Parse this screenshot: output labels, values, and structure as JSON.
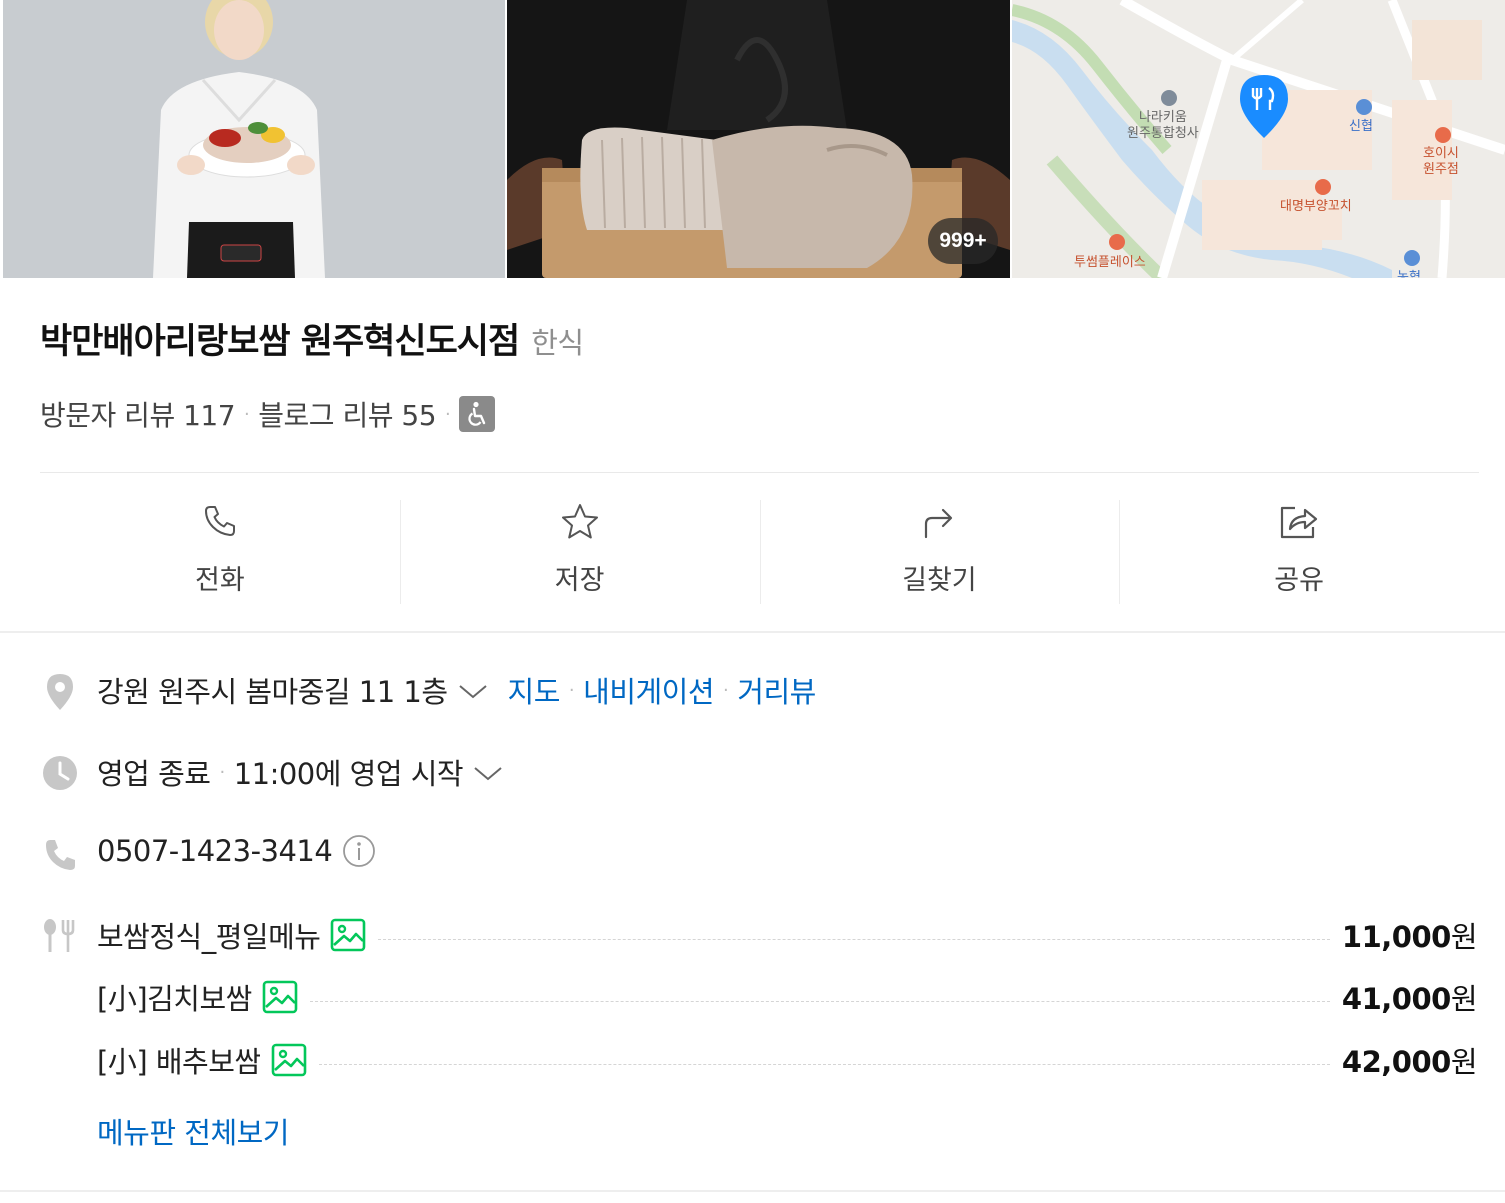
{
  "photos": {
    "count_badge": "999+",
    "map_labels": [
      "나라키움\n원주통합청사",
      "신협",
      "호이시\n원주점",
      "대명부양꼬치",
      "투썸플레이스",
      "농협"
    ]
  },
  "place": {
    "name": "박만배아리랑보쌈 원주혁신도시점",
    "category": "한식",
    "visitor_reviews": "방문자 리뷰 117",
    "blog_reviews": "블로그 리뷰 55",
    "separator": "·"
  },
  "actions": [
    {
      "label": "전화",
      "icon": "phone-icon"
    },
    {
      "label": "저장",
      "icon": "star-icon"
    },
    {
      "label": "길찾기",
      "icon": "directions-icon"
    },
    {
      "label": "공유",
      "icon": "share-icon"
    }
  ],
  "info": {
    "address": "강원 원주시 봄마중길 11 1층",
    "address_links": [
      "지도",
      "내비게이션",
      "거리뷰"
    ],
    "status": "영업 종료",
    "status_detail": "11:00에 영업 시작",
    "phone": "0507-1423-3414"
  },
  "menu": {
    "items": [
      {
        "name": "보쌈정식_평일메뉴",
        "price": "11,000",
        "unit": "원"
      },
      {
        "name": "[小]김치보쌈",
        "price": "41,000",
        "unit": "원"
      },
      {
        "name": "[小] 배추보쌈",
        "price": "42,000",
        "unit": "원"
      }
    ],
    "more_link": "메뉴판 전체보기"
  },
  "colors": {
    "link": "#0068c3",
    "map_pin": "#1a8cff",
    "photo_icon": "#03c75a",
    "muted": "#8f8f8f"
  }
}
